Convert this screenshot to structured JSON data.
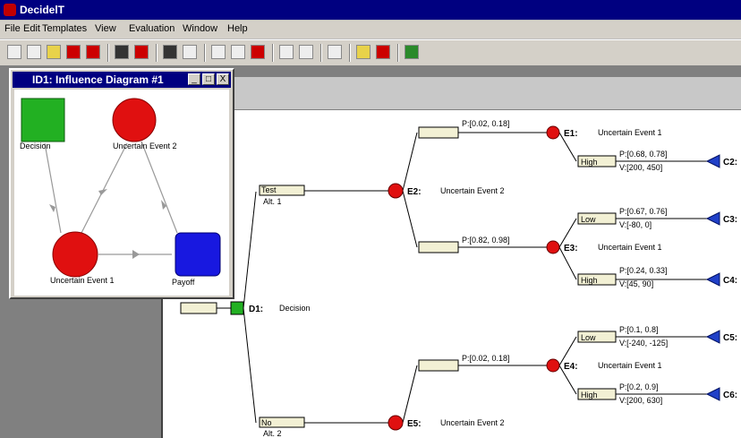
{
  "app": {
    "title": "DecidelT"
  },
  "menu": [
    "File",
    "Edit",
    "Templates",
    "View",
    "Evaluation",
    "Window",
    "Help"
  ],
  "toolbar_icons": [
    "new-icon",
    "open-id-icon",
    "open-folder-icon",
    "open-red-icon",
    "open-red2-icon",
    "save-icon",
    "save-red-icon",
    "print-preview-icon",
    "print-icon",
    "text-icon",
    "search-icon",
    "delete-icon",
    "p-icon",
    "v-icon",
    "flip-icon",
    "play-icon",
    "stop-icon",
    "refresh-icon"
  ],
  "influence_window": {
    "title": "ID1: Influence Diagram #1",
    "nodes": {
      "decision": "Decision",
      "uncertain2": "Uncertain Event 2",
      "uncertain1": "Uncertain Event 1",
      "payoff": "Payoff"
    },
    "buttons": [
      "_",
      "□",
      "X"
    ]
  },
  "tree": {
    "d1": {
      "id": "D1:",
      "name": "Decision"
    },
    "alt1": {
      "label": "Test",
      "sub": "Alt. 1"
    },
    "alt2": {
      "label": "No",
      "sub": "Alt. 2"
    },
    "e2": {
      "id": "E2:",
      "name": "Uncertain Event 2"
    },
    "e5": {
      "id": "E5:",
      "name": "Uncertain Event 2"
    },
    "e1": {
      "id": "E1:",
      "name": "Uncertain Event 1"
    },
    "e3": {
      "id": "E3:",
      "name": "Uncertain Event 1"
    },
    "e4": {
      "id": "E4:",
      "name": "Uncertain Event 1"
    },
    "e2_top_prob": "P:[0.02, 0.18]",
    "e2_bot_prob": "P:[0.82, 0.98]",
    "e5_top_prob": "P:[0.02, 0.18]",
    "e1_high": {
      "label": "High",
      "p": "P:[0.68, 0.78]",
      "v": "V:[200, 450]",
      "c": "C2:"
    },
    "e3_low": {
      "label": "Low",
      "p": "P:[0.67, 0.76]",
      "v": "V:[-80, 0]",
      "c": "C3:"
    },
    "e3_high": {
      "label": "High",
      "p": "P:[0.24, 0.33]",
      "v": "V:[45, 90]",
      "c": "C4:"
    },
    "e4_low": {
      "label": "Low",
      "p": "P:[0.1, 0.8]",
      "v": "V:[-240, -125]",
      "c": "C5:"
    },
    "e4_high": {
      "label": "High",
      "p": "P:[0.2, 0.9]",
      "v": "V:[200, 630]",
      "c": "C6:"
    }
  },
  "colors": {
    "title_bar": "#000080",
    "decision": "#22b022",
    "chance": "#e01010",
    "payoff": "#1818e0",
    "terminal": "#2040c8",
    "branch_box": "#f2f0d4"
  }
}
